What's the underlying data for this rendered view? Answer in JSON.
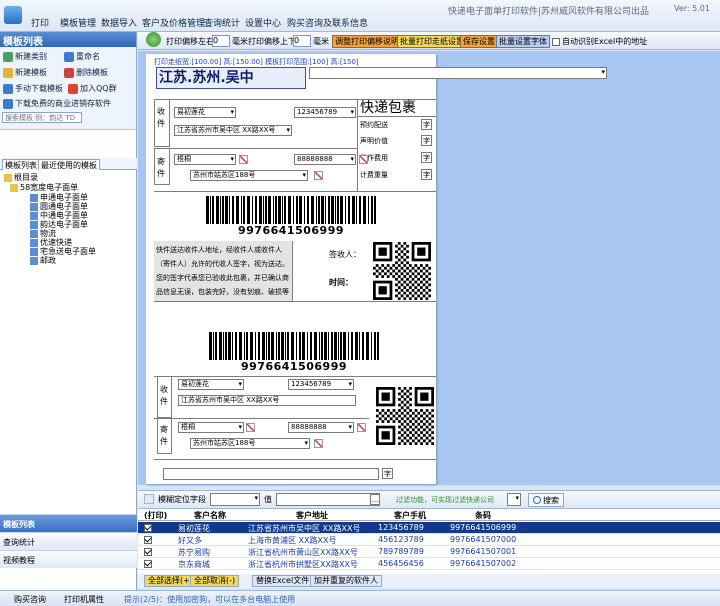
{
  "app_title": "快递电子面单打印软件|苏州威风软件有限公司出品",
  "version": "Ver: 5.01",
  "menu": [
    "打印",
    "模板管理",
    "数据导入",
    "客户及价格管理",
    "查询统计",
    "设置中心",
    "购买咨询及联系信息"
  ],
  "left": {
    "header": "模板列表",
    "actions": {
      "new_category": "新建类别",
      "rename": "重命名",
      "new_template": "新建模板",
      "delete_template": "删除模板",
      "manual_download": "手动下载模板",
      "join_qq": "加入QQ群",
      "free_store_software": "下载免费的商业进销存软件"
    },
    "search_placeholder": "搜索模板 例：韵达 TD",
    "tabs": [
      "模板列表",
      "最近使用的模板"
    ],
    "tree": {
      "root": "根目录",
      "folder": "58宽度电子面单",
      "items": [
        "申通电子面单",
        "圆通电子面单",
        "中通电子面单",
        "韵达电子面单",
        "物流",
        "优速快递",
        "宅急送电子面单",
        "邮政"
      ]
    },
    "nav": [
      "模板列表",
      "查询统计",
      "视频教程"
    ]
  },
  "toolbar": {
    "offset_lr_label": "打印偏移左右",
    "offset_lr_value": "0",
    "unit": "毫米",
    "offset_ud_label": "打印偏移上下",
    "offset_ud_value": "0",
    "btn_adjust_help": "调整打印偏移说明",
    "btn_batch_border": "批量打印走纸设置",
    "btn_save": "保存设置",
    "btn_batch_font": "批量设置字体",
    "auto_excel_label": "自动识别Excel中的地址"
  },
  "canvas": {
    "ruler_text": "打印走纸宽:[100.00] 高:[150.00] 模板打印范围:[100] 高:[150]",
    "region_field": "江苏.苏州.吴中",
    "express_title": "快递包裹",
    "recipient_label": "收件",
    "sender_label": "寄件",
    "recipient_name": "易初莲花",
    "recipient_phone": "123456789",
    "recipient_address": "江苏省苏州市吴中区 XX路XX号",
    "sender_name": "梧桐",
    "sender_phone": "88888888",
    "sender_address": "苏州市姑苏区188号",
    "info_fields": [
      "预约配送",
      "声明价值",
      "操作费用",
      "计费重量"
    ],
    "zi": "字",
    "barcode_number": "9976641506999",
    "sign_text": "快件送达收件人地址，经收件人或收件人（寄件人）允许的代收人签字，视为送达。您的签字代表您已验收此包裹，并已确认商品信息无误，包装完好，没有划痕、破损等",
    "signer_label": "签收人：",
    "time_label": "时间："
  },
  "filter": {
    "label": "模糊定位字段",
    "value_label": "值",
    "filter_note": "过滤功能，可实现过滤快递公司",
    "search_btn": "搜索"
  },
  "grid": {
    "headers": [
      "(打印)",
      "客户名称",
      "客户地址",
      "客户手机",
      "条码"
    ],
    "rows": [
      {
        "name": "易初莲花",
        "address": "江苏省苏州市吴中区 XX路XX号",
        "phone": "123456789",
        "barcode": "9976641506999"
      },
      {
        "name": "好又多",
        "address": "上海市黄浦区 XX路XX号",
        "phone": "456123789",
        "barcode": "9976641507000"
      },
      {
        "name": "苏宁易购",
        "address": "浙江省杭州市萧山区XX路XX号",
        "phone": "789789789",
        "barcode": "9976641507001"
      },
      {
        "name": "京东商城",
        "address": "浙江省杭州市拱墅区XX路XX号",
        "phone": "456456456",
        "barcode": "9976641507002"
      }
    ]
  },
  "bottom_actions": [
    "全部选择(+)",
    "全部取消(-)",
    "替换Excel文件",
    "加并重复的软件人"
  ],
  "status": {
    "buy": "购买咨询",
    "printer": "打印机属性",
    "hint": "提示(2/5)：使用加密狗，可以在多台电脑上使用"
  },
  "colors": {
    "accent": "#2f66b8",
    "selected_row": "#113a8f",
    "canvas_bg": "#a8c6f2",
    "btn_red": "#f2a33a",
    "btn_yellow": "#f4d85a"
  }
}
